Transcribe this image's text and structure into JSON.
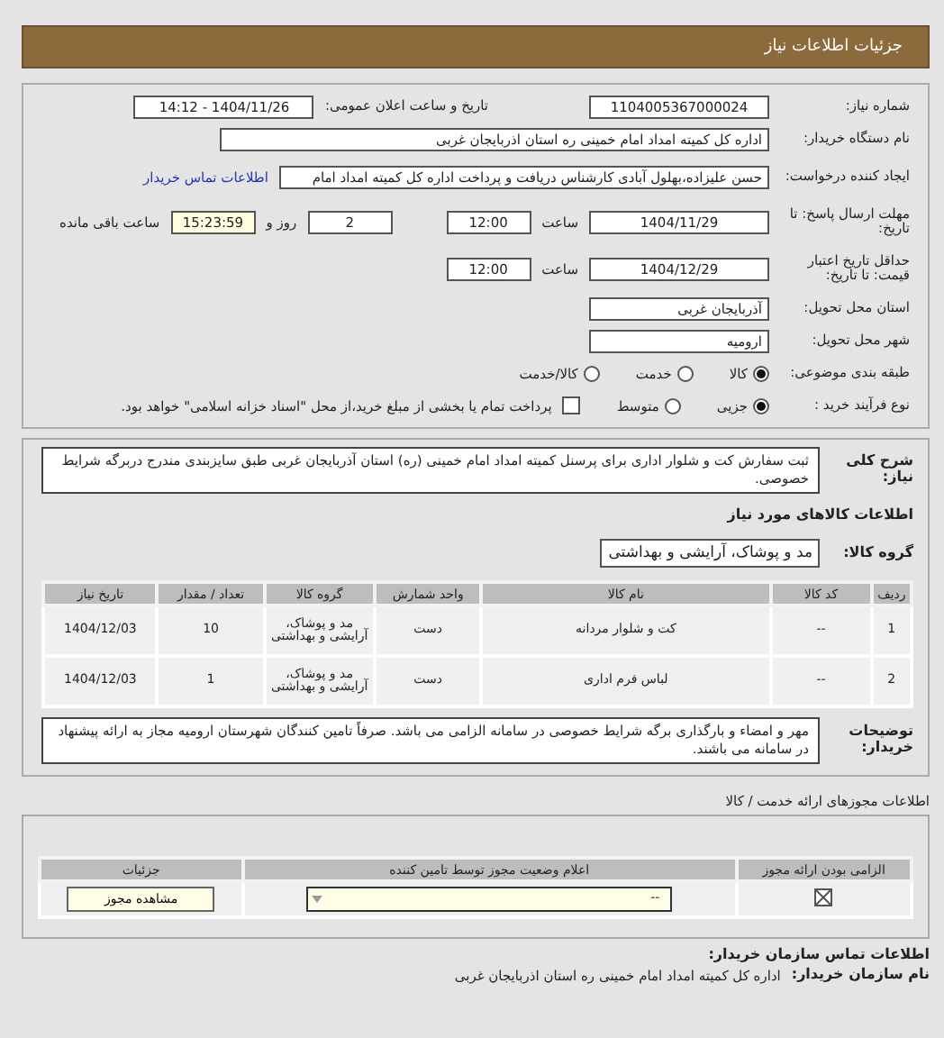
{
  "header": {
    "title": "جزئیات اطلاعات نیاز"
  },
  "form": {
    "need_number": {
      "label": "شماره نیاز:",
      "value": "1104005367000024"
    },
    "announce": {
      "label": "تاریخ و ساعت اعلان عمومی:",
      "value": "1404/11/26 - 14:12"
    },
    "buyer": {
      "label": "نام دستگاه خریدار:",
      "value": "اداره کل کمیته امداد امام خمینی  ره  استان اذربایجان غربی"
    },
    "creator": {
      "label": "ایجاد کننده درخواست:",
      "value": "حسن علیزاده،بهلول آبادی کارشناس دریافت و پرداخت اداره کل کمیته امداد امام",
      "link": "اطلاعات تماس خریدار"
    },
    "deadline": {
      "label": "مهلت ارسال پاسخ: تا تاریخ:",
      "date": "1404/11/29",
      "time_label": "ساعت",
      "time": "12:00",
      "days": "2",
      "days_label": "روز و",
      "remaining": "15:23:59",
      "remaining_label": "ساعت باقی مانده"
    },
    "validity": {
      "label": "حداقل تاریخ اعتبار قیمت: تا تاریخ:",
      "date": "1404/12/29",
      "time_label": "ساعت",
      "time": "12:00"
    },
    "province": {
      "label": "استان محل تحویل:",
      "value": "آذربایجان غربی"
    },
    "city": {
      "label": "شهر محل تحویل:",
      "value": "ارومیه"
    },
    "category": {
      "label": "طبقه بندی موضوعی:",
      "options": [
        {
          "label": "کالا",
          "selected": true
        },
        {
          "label": "خدمت",
          "selected": false
        },
        {
          "label": "کالا/خدمت",
          "selected": false
        }
      ]
    },
    "process": {
      "label": "نوع فرآیند خرید :",
      "options": [
        {
          "label": "جزیی",
          "selected": true
        },
        {
          "label": "متوسط",
          "selected": false
        }
      ],
      "treasury": {
        "checked": false,
        "label": "پرداخت تمام یا بخشی از مبلغ خرید،از محل \"اسناد خزانه اسلامی\" خواهد بود."
      }
    }
  },
  "description": {
    "label": "شرح کلی نیاز:",
    "text": "ثبت سفارش کت و شلوار اداری برای پرسنل کمیته امداد امام خمینی (ره) استان آذربایجان غربی طبق سایزبندی مندرج دربرگه شرایط خصوصی."
  },
  "goods": {
    "title": "اطلاعات کالاهای مورد نیاز",
    "group_label": "گروه کالا:",
    "group": "مد و پوشاک، آرایشی و بهداشتی",
    "columns": [
      "ردیف",
      "کد کالا",
      "نام کالا",
      "واحد شمارش",
      "گروه کالا",
      "تعداد / مقدار",
      "تاریخ نیاز"
    ],
    "rows": [
      [
        "1",
        "--",
        "کت و شلوار مردانه",
        "دست",
        "مد و پوشاک، آرایشی و بهداشتی",
        "10",
        "1404/12/03"
      ],
      [
        "2",
        "--",
        "لباس فرم اداری",
        "دست",
        "مد و پوشاک، آرایشی و بهداشتی",
        "1",
        "1404/12/03"
      ]
    ]
  },
  "notes": {
    "label": "توضیحات خریدار:",
    "text": "مهر و امضاء و بارگذاری برگه شرایط خصوصی در سامانه الزامی می باشد. صرفاً تامین کنندگان شهرستان ارومیه مجاز به ارائه پیشنهاد در سامانه می باشند."
  },
  "licenses": {
    "title": "اطلاعات مجوزهای ارائه خدمت / کالا",
    "columns": [
      "الزامی بودن ارائه مجوز",
      "اعلام وضعیت مجوز توسط تامین کننده",
      "جزئیات"
    ],
    "rows": [
      {
        "required": true,
        "status": "--",
        "button": "مشاهده مجوز"
      }
    ]
  },
  "contact": {
    "title": "اطلاعات تماس سازمان خریدار:",
    "org_label": "نام سازمان خریدار:",
    "org": "اداره کل کمیته امداد امام خمینی ره استان اذربایجان غربی"
  }
}
